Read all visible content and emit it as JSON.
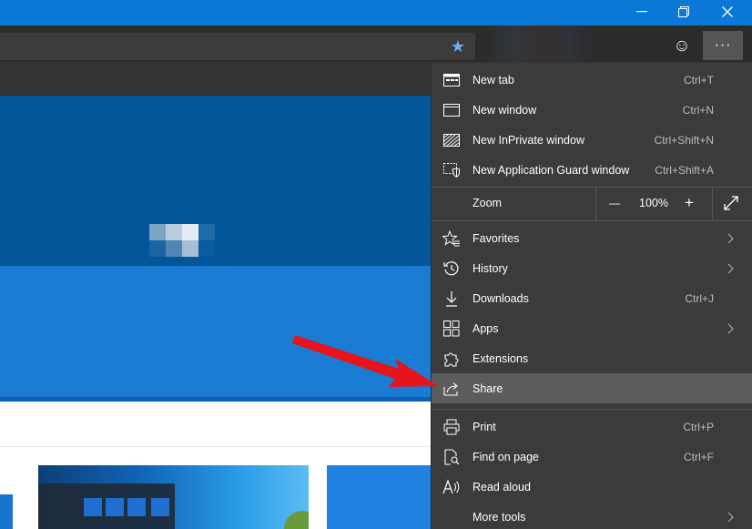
{
  "window": {
    "minimize_glyph": "—",
    "more_glyph": "···",
    "emoji_glyph": "☺",
    "favorite_glyph": "★"
  },
  "colors": {
    "titlebar": "#0a78d7",
    "menu_bg": "#3b3b3b",
    "menu_hover": "#5c5c5c",
    "accent_star": "#6ab0f3",
    "arrow_red": "#e8141b"
  },
  "menu": {
    "items": [
      {
        "label": "New tab",
        "shortcut": "Ctrl+T",
        "icon": "new-tab-icon"
      },
      {
        "label": "New window",
        "shortcut": "Ctrl+N",
        "icon": "new-window-icon"
      },
      {
        "label": "New InPrivate window",
        "shortcut": "Ctrl+Shift+N",
        "icon": "inprivate-icon"
      },
      {
        "label": "New Application Guard window",
        "shortcut": "Ctrl+Shift+A",
        "icon": "application-guard-icon"
      },
      {
        "label": "Favorites",
        "shortcut": "",
        "icon": "favorites-icon",
        "submenu": true
      },
      {
        "label": "History",
        "shortcut": "",
        "icon": "history-icon",
        "submenu": true
      },
      {
        "label": "Downloads",
        "shortcut": "Ctrl+J",
        "icon": "downloads-icon"
      },
      {
        "label": "Apps",
        "shortcut": "",
        "icon": "apps-icon",
        "submenu": true
      },
      {
        "label": "Extensions",
        "shortcut": "",
        "icon": "extensions-icon"
      },
      {
        "label": "Share",
        "shortcut": "",
        "icon": "share-icon",
        "highlighted": true
      },
      {
        "label": "Print",
        "shortcut": "Ctrl+P",
        "icon": "print-icon"
      },
      {
        "label": "Find on page",
        "shortcut": "Ctrl+F",
        "icon": "find-icon"
      },
      {
        "label": "Read aloud",
        "shortcut": "",
        "icon": "read-aloud-icon"
      },
      {
        "label": "More tools",
        "shortcut": "",
        "icon": "",
        "submenu": true
      }
    ],
    "zoom": {
      "label": "Zoom",
      "minus": "—",
      "value": "100%",
      "plus": "+"
    }
  }
}
